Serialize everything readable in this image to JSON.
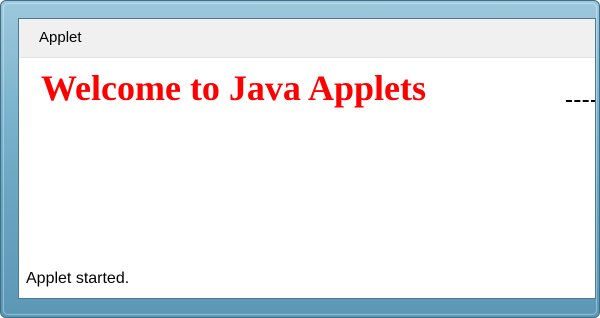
{
  "menubar": {
    "items": [
      {
        "label": "Applet"
      }
    ]
  },
  "canvas": {
    "message": "Welcome to Java Applets",
    "message_color": "#ff0000"
  },
  "status": {
    "text": "Applet started."
  },
  "colors": {
    "frame": "#7fb6cf",
    "menubar_bg": "#f0f0f0",
    "canvas_bg": "#ffffff"
  }
}
